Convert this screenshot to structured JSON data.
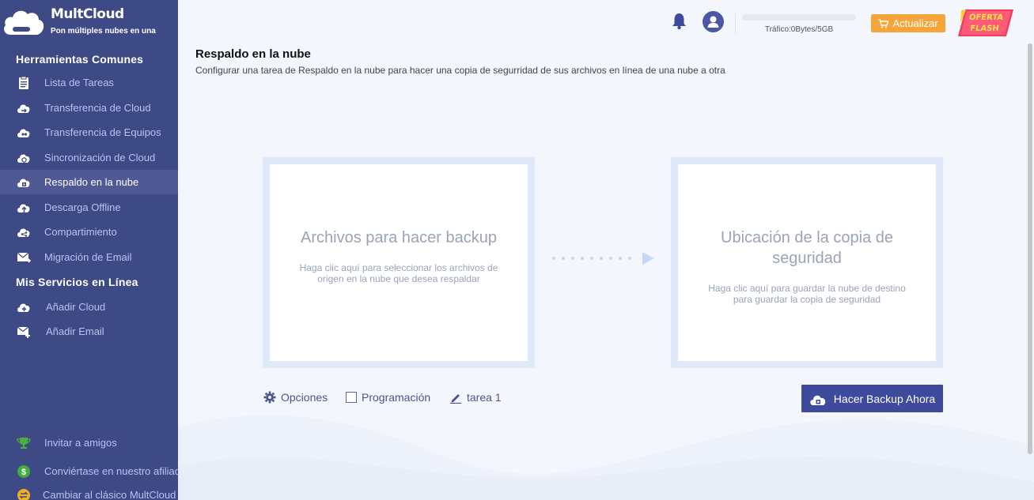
{
  "app": {
    "name": "MultCloud",
    "tagline": "Pon múltiples nubes en una"
  },
  "sidebar": {
    "section1": "Herramientas Comunes",
    "items": [
      {
        "label": "Lista de Tareas",
        "icon": "task-list-icon"
      },
      {
        "label": "Transferencia de Cloud",
        "icon": "cloud-transfer-icon"
      },
      {
        "label": "Transferencia de Equipos",
        "icon": "team-transfer-icon"
      },
      {
        "label": "Sincronización de Cloud",
        "icon": "cloud-sync-icon"
      },
      {
        "label": "Respaldo en la nube",
        "icon": "cloud-backup-icon",
        "active": true
      },
      {
        "label": "Descarga Offline",
        "icon": "offline-download-icon"
      },
      {
        "label": "Compartimiento",
        "icon": "share-icon"
      },
      {
        "label": "Migración de Email",
        "icon": "email-migration-icon"
      }
    ],
    "section2": "Mis Servicios en Línea",
    "services": [
      {
        "label": "Añadir Cloud",
        "icon": "add-cloud-icon"
      },
      {
        "label": "Añadir Email",
        "icon": "add-email-icon"
      }
    ],
    "bottom": [
      {
        "label": "Invitar a amigos",
        "icon": "trophy-icon"
      },
      {
        "label": "Conviértase en nuestro afiliado",
        "icon": "dollar-icon"
      },
      {
        "label": "Cambiar al clásico MultCloud",
        "icon": "switch-classic-icon"
      }
    ]
  },
  "header": {
    "traffic": "Tráfico:0Bytes/5GB",
    "traffic_used_fraction": 0,
    "upgrade_label": "Actualizar",
    "flash_line1": "OFERTA",
    "flash_line2": "FLASH"
  },
  "main": {
    "title": "Respaldo en la nube",
    "description": "Configurar una tarea de Respaldo en la nube para hacer una copia de segurridad de sus archivos en línea de una nube a otra",
    "source": {
      "title": "Archivos para hacer backup",
      "desc_line1": "Haga clic aquí para seleccionar los archivos de",
      "desc_line2": "origen en la nube que desea respaldar"
    },
    "target": {
      "title_line1": "Ubicación de la copia de",
      "title_line2": "seguridad",
      "desc_line1": "Haga clic aquí para guardar la nube de destino",
      "desc_line2": "para guardar la copia de seguridad"
    },
    "options_label": "Opciones",
    "schedule_label": "Programación",
    "task_name": "tarea 1",
    "backup_button": "Hacer Backup Ahora"
  },
  "colors": {
    "sidebar": "#3e4a85",
    "accent": "#3e4a9c",
    "upgrade": "#f7a53b",
    "panel": "#dfe9f9"
  }
}
